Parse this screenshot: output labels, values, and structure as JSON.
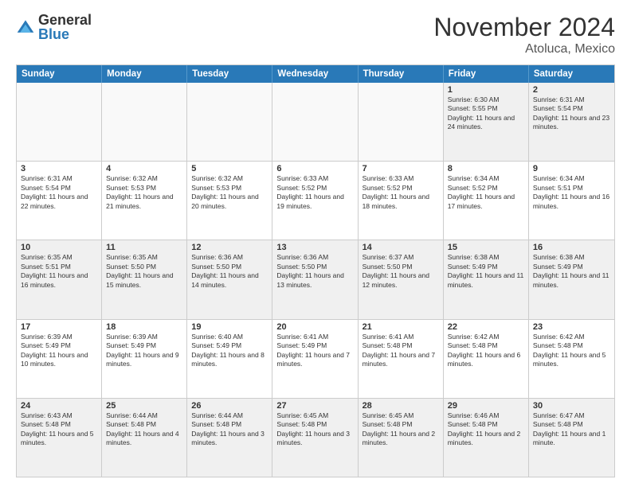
{
  "logo": {
    "general": "General",
    "blue": "Blue"
  },
  "header": {
    "month": "November 2024",
    "location": "Atoluca, Mexico"
  },
  "weekdays": [
    "Sunday",
    "Monday",
    "Tuesday",
    "Wednesday",
    "Thursday",
    "Friday",
    "Saturday"
  ],
  "rows": [
    [
      {
        "day": "",
        "info": ""
      },
      {
        "day": "",
        "info": ""
      },
      {
        "day": "",
        "info": ""
      },
      {
        "day": "",
        "info": ""
      },
      {
        "day": "",
        "info": ""
      },
      {
        "day": "1",
        "info": "Sunrise: 6:30 AM\nSunset: 5:55 PM\nDaylight: 11 hours and 24 minutes."
      },
      {
        "day": "2",
        "info": "Sunrise: 6:31 AM\nSunset: 5:54 PM\nDaylight: 11 hours and 23 minutes."
      }
    ],
    [
      {
        "day": "3",
        "info": "Sunrise: 6:31 AM\nSunset: 5:54 PM\nDaylight: 11 hours and 22 minutes."
      },
      {
        "day": "4",
        "info": "Sunrise: 6:32 AM\nSunset: 5:53 PM\nDaylight: 11 hours and 21 minutes."
      },
      {
        "day": "5",
        "info": "Sunrise: 6:32 AM\nSunset: 5:53 PM\nDaylight: 11 hours and 20 minutes."
      },
      {
        "day": "6",
        "info": "Sunrise: 6:33 AM\nSunset: 5:52 PM\nDaylight: 11 hours and 19 minutes."
      },
      {
        "day": "7",
        "info": "Sunrise: 6:33 AM\nSunset: 5:52 PM\nDaylight: 11 hours and 18 minutes."
      },
      {
        "day": "8",
        "info": "Sunrise: 6:34 AM\nSunset: 5:52 PM\nDaylight: 11 hours and 17 minutes."
      },
      {
        "day": "9",
        "info": "Sunrise: 6:34 AM\nSunset: 5:51 PM\nDaylight: 11 hours and 16 minutes."
      }
    ],
    [
      {
        "day": "10",
        "info": "Sunrise: 6:35 AM\nSunset: 5:51 PM\nDaylight: 11 hours and 16 minutes."
      },
      {
        "day": "11",
        "info": "Sunrise: 6:35 AM\nSunset: 5:50 PM\nDaylight: 11 hours and 15 minutes."
      },
      {
        "day": "12",
        "info": "Sunrise: 6:36 AM\nSunset: 5:50 PM\nDaylight: 11 hours and 14 minutes."
      },
      {
        "day": "13",
        "info": "Sunrise: 6:36 AM\nSunset: 5:50 PM\nDaylight: 11 hours and 13 minutes."
      },
      {
        "day": "14",
        "info": "Sunrise: 6:37 AM\nSunset: 5:50 PM\nDaylight: 11 hours and 12 minutes."
      },
      {
        "day": "15",
        "info": "Sunrise: 6:38 AM\nSunset: 5:49 PM\nDaylight: 11 hours and 11 minutes."
      },
      {
        "day": "16",
        "info": "Sunrise: 6:38 AM\nSunset: 5:49 PM\nDaylight: 11 hours and 11 minutes."
      }
    ],
    [
      {
        "day": "17",
        "info": "Sunrise: 6:39 AM\nSunset: 5:49 PM\nDaylight: 11 hours and 10 minutes."
      },
      {
        "day": "18",
        "info": "Sunrise: 6:39 AM\nSunset: 5:49 PM\nDaylight: 11 hours and 9 minutes."
      },
      {
        "day": "19",
        "info": "Sunrise: 6:40 AM\nSunset: 5:49 PM\nDaylight: 11 hours and 8 minutes."
      },
      {
        "day": "20",
        "info": "Sunrise: 6:41 AM\nSunset: 5:49 PM\nDaylight: 11 hours and 7 minutes."
      },
      {
        "day": "21",
        "info": "Sunrise: 6:41 AM\nSunset: 5:48 PM\nDaylight: 11 hours and 7 minutes."
      },
      {
        "day": "22",
        "info": "Sunrise: 6:42 AM\nSunset: 5:48 PM\nDaylight: 11 hours and 6 minutes."
      },
      {
        "day": "23",
        "info": "Sunrise: 6:42 AM\nSunset: 5:48 PM\nDaylight: 11 hours and 5 minutes."
      }
    ],
    [
      {
        "day": "24",
        "info": "Sunrise: 6:43 AM\nSunset: 5:48 PM\nDaylight: 11 hours and 5 minutes."
      },
      {
        "day": "25",
        "info": "Sunrise: 6:44 AM\nSunset: 5:48 PM\nDaylight: 11 hours and 4 minutes."
      },
      {
        "day": "26",
        "info": "Sunrise: 6:44 AM\nSunset: 5:48 PM\nDaylight: 11 hours and 3 minutes."
      },
      {
        "day": "27",
        "info": "Sunrise: 6:45 AM\nSunset: 5:48 PM\nDaylight: 11 hours and 3 minutes."
      },
      {
        "day": "28",
        "info": "Sunrise: 6:45 AM\nSunset: 5:48 PM\nDaylight: 11 hours and 2 minutes."
      },
      {
        "day": "29",
        "info": "Sunrise: 6:46 AM\nSunset: 5:48 PM\nDaylight: 11 hours and 2 minutes."
      },
      {
        "day": "30",
        "info": "Sunrise: 6:47 AM\nSunset: 5:48 PM\nDaylight: 11 hours and 1 minute."
      }
    ]
  ]
}
